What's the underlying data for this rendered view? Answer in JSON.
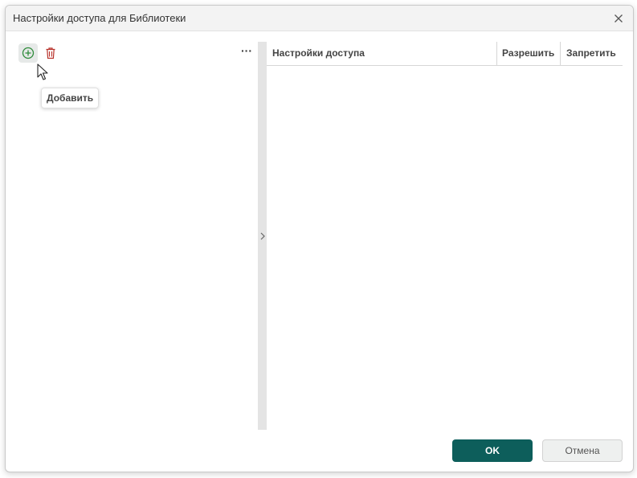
{
  "dialog": {
    "title": "Настройки доступа для Библиотеки"
  },
  "toolbar": {
    "add_icon": "add-circle-icon",
    "delete_icon": "trash-icon",
    "more_label": "···",
    "add_tooltip": "Добавить"
  },
  "grid": {
    "columns": [
      "Настройки доступа",
      "Разрешить",
      "Запретить"
    ]
  },
  "footer": {
    "ok_label": "OK",
    "cancel_label": "Отмена"
  },
  "colors": {
    "primary": "#0d5e5b",
    "add_icon": "#2e8b3a",
    "delete_icon": "#b8322b"
  }
}
